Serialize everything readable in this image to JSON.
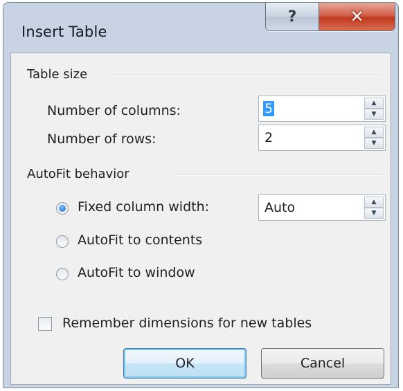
{
  "dialog": {
    "title": "Insert Table",
    "help_glyph": "?",
    "close_glyph": "✕"
  },
  "table_size": {
    "label": "Table size",
    "columns_label": "Number of columns:",
    "columns_value": "5",
    "rows_label": "Number of rows:",
    "rows_value": "2"
  },
  "autofit": {
    "label": "AutoFit behavior",
    "fixed_label": "Fixed column width:",
    "fixed_value": "Auto",
    "contents_label": "AutoFit to contents",
    "window_label": "AutoFit to window",
    "selected": "Fixed column width:"
  },
  "remember": {
    "label": "Remember dimensions for new tables",
    "checked": false
  },
  "buttons": {
    "ok": "OK",
    "cancel": "Cancel"
  },
  "spin_icons": {
    "up": "▲",
    "down": "▼"
  }
}
